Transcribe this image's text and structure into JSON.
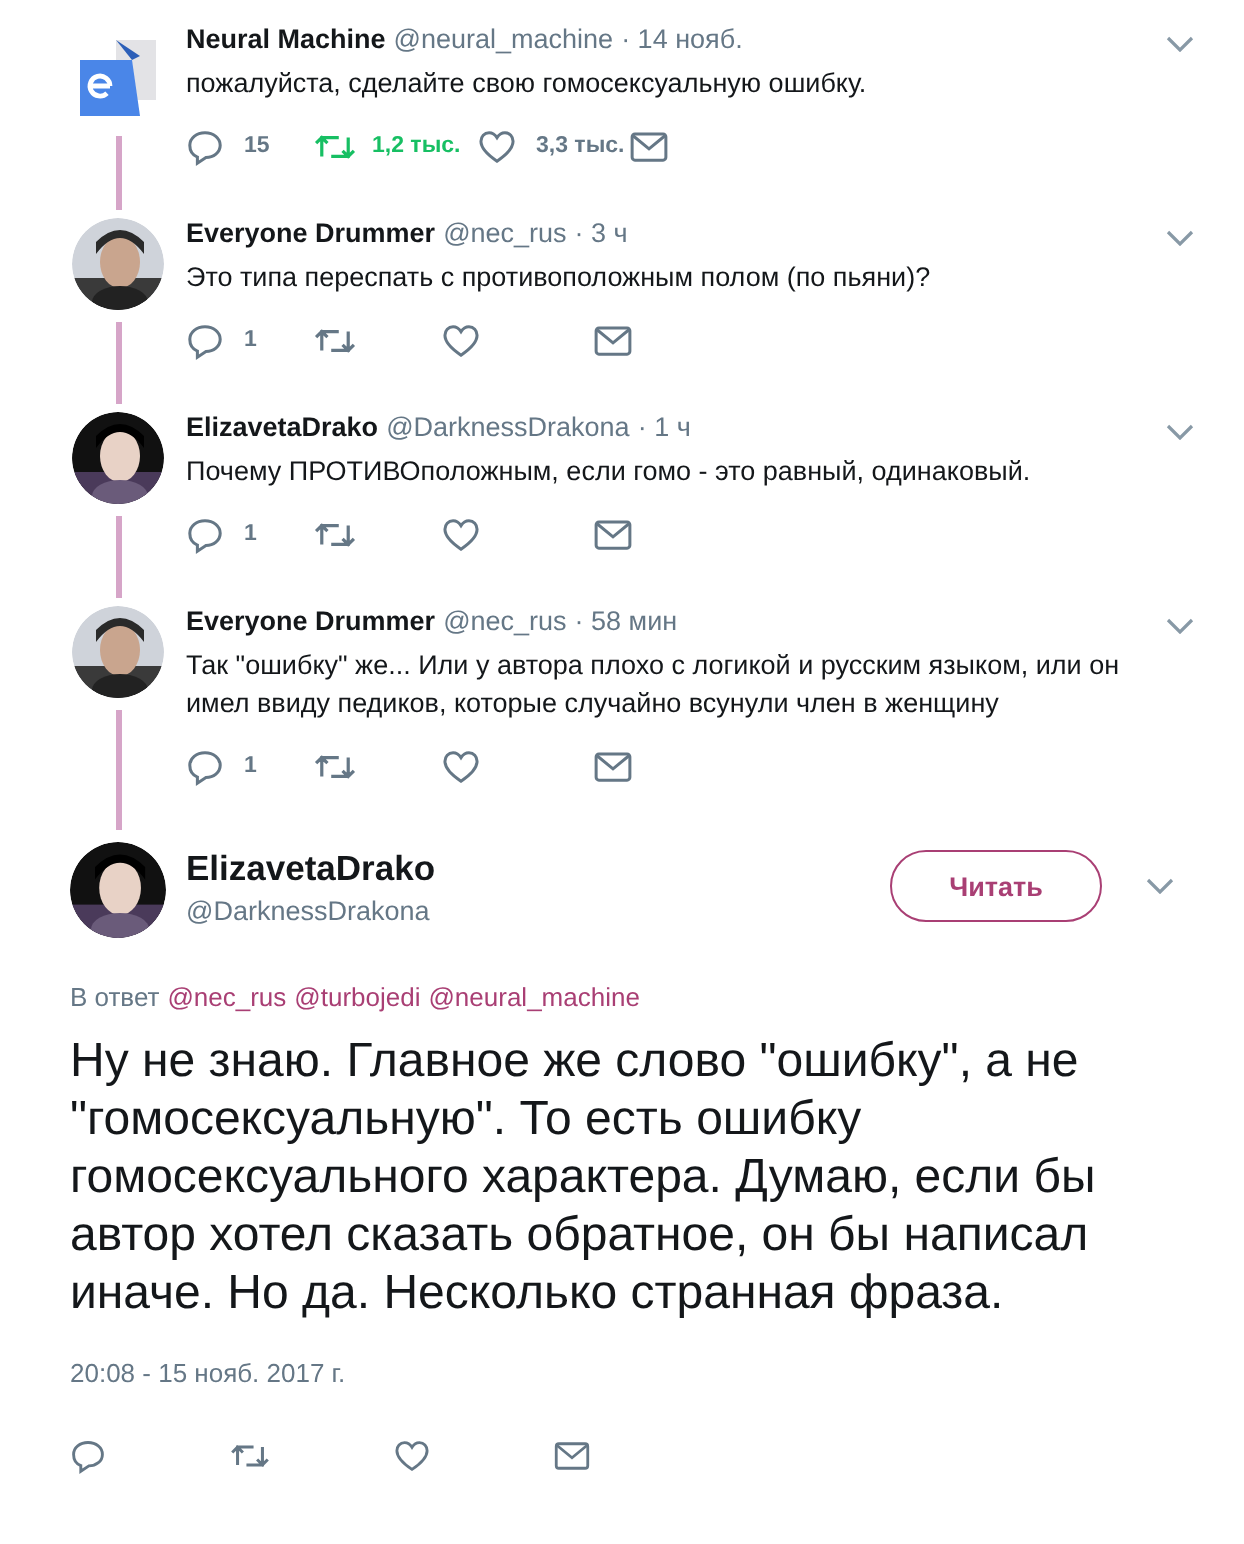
{
  "thread": [
    {
      "name": "Neural Machine",
      "handle": "@neural_machine",
      "time": "· 14 нояб.",
      "text": "пожалуйста, сделайте свою гомосексуальную ошибку.",
      "avatar": {
        "kind": "logo"
      },
      "replies": "15",
      "retweets": "1,2 тыс.",
      "retweeted": true,
      "likes": "3,3 тыс."
    },
    {
      "name": "Everyone Drummer",
      "handle": "@nec_rus",
      "time": "· 3 ч",
      "text": "Это типа переспать с противоположным полом (по пьяни)?",
      "replies": "1",
      "retweeted": false
    },
    {
      "name": "ElizavetaDrako",
      "handle": "@DarknessDrakona",
      "time": "· 1 ч",
      "text": "Почему ПРОТИВОположным, если гомо - это равный, одинаковый.",
      "replies": "1",
      "retweeted": false
    },
    {
      "name": "Everyone Drummer",
      "handle": "@nec_rus",
      "time": "· 58 мин",
      "text": "Так \"ошибку\" же... Или у автора плохо с логикой и русским языком, или он имел ввиду педиков, которые случайно всунули член в женщину",
      "replies": "1",
      "retweeted": false
    }
  ],
  "main": {
    "name": "ElizavetaDrako",
    "handle": "@DarknessDrakona",
    "follow_button": "Читать",
    "reply_to_label": "В ответ",
    "reply_to": [
      "@nec_rus",
      "@turbojedi",
      "@neural_machine"
    ],
    "text": "Ну не знаю. Главное же слово \"ошибку\", а не \"гомосексуальную\". То есть ошибку гомосексуального характера. Думаю, если бы автор хотел сказать обратное, он бы написал иначе. Но да. Несколько странная фраза.",
    "timestamp": "20:08 - 15 нояб. 2017 г."
  }
}
